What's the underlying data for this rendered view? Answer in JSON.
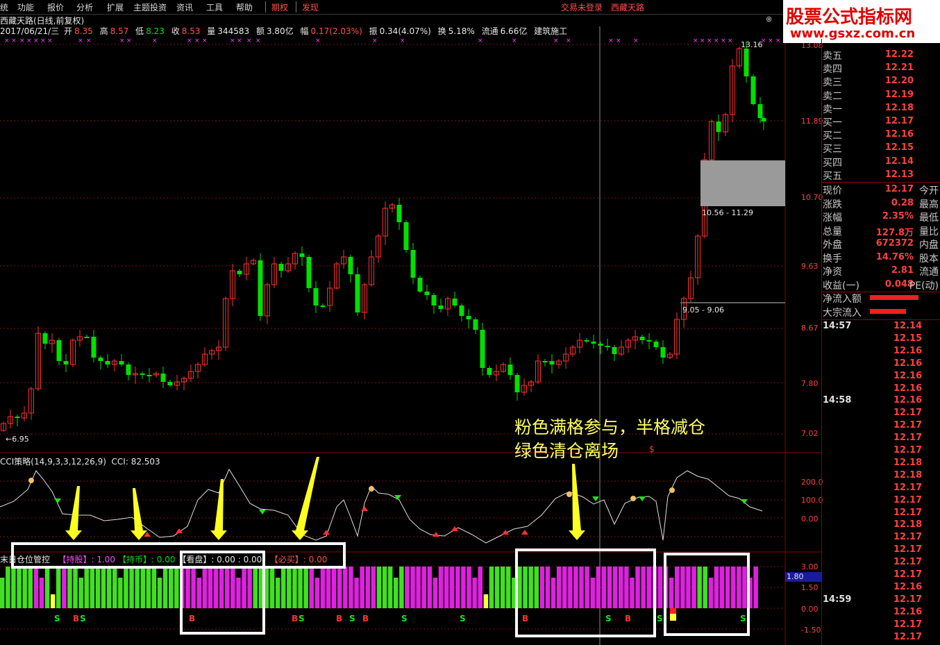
{
  "menubar": {
    "items": [
      "统",
      "功能",
      "报价",
      "分析",
      "扩展",
      "主题投资",
      "资讯",
      "工具",
      "帮助",
      "期权",
      "发现"
    ],
    "status_left": "交易未登录",
    "status_right": "西藏天路",
    "close_glyph": "×"
  },
  "stock": {
    "title": "西藏天路(日线,前复权)",
    "date": "2017/06/21/三",
    "open_label": "开",
    "open": "8.35",
    "high_label": "高",
    "high": "8.57",
    "low_label": "低",
    "low": "8.23",
    "close_label": "收",
    "close": "8.53",
    "vol_label": "量",
    "vol": "344583",
    "amount_label": "额",
    "amount": "3.80亿",
    "change_label": "幅",
    "change": "0.17(2.03%)",
    "amp_label": "振",
    "amp": "0.34(4.07%)",
    "turnover_label": "换",
    "turnover": "5.18%",
    "float_label": "流通",
    "float": "6.66亿",
    "sector": "建筑施工"
  },
  "logo": {
    "line1": "股票公式指标网",
    "line2": "www.gsxz.com.cn"
  },
  "price_axis": [
    "13.08",
    "11.89",
    "10.70",
    "9.63",
    "8.67",
    "7.80",
    "7.02"
  ],
  "price_annotations": {
    "high": "13.16",
    "low": "6.95",
    "zone_high": "10.56 - 11.29",
    "zone_low": "9.05 - 9.06"
  },
  "cci": {
    "title": "CCI策略(14,9,3,3,12,26,9)",
    "value_label": "CCI: 82.503",
    "axis": [
      "200.0",
      "100.0",
      "0.00"
    ]
  },
  "position_panel": {
    "title": "末日仓位管控",
    "hold_label": "【持股】",
    "hold_value": ": 1.00",
    "cash_label": "【持币】",
    "cash_value": ": 0.00",
    "watch_label": "【看盘】",
    "watch_value": ": 0.00 : 0.00",
    "must_buy_label": "【必买】",
    "must_buy_value": ": 0.00",
    "axis": [
      "3.00",
      "1.50",
      "0.00",
      "-1.50"
    ],
    "current_value": "1.80"
  },
  "annotation": {
    "line1": "粉色满格参与，半格减仓",
    "line2": "绿色清仓离场"
  },
  "order_book": [
    {
      "label": "卖五",
      "price": "12.22"
    },
    {
      "label": "卖四",
      "price": "12.21"
    },
    {
      "label": "卖三",
      "price": "12.20"
    },
    {
      "label": "卖二",
      "price": "12.19"
    },
    {
      "label": "卖一",
      "price": "12.18"
    },
    {
      "label": "买一",
      "price": "12.17"
    },
    {
      "label": "买二",
      "price": "12.16"
    },
    {
      "label": "买三",
      "price": "12.15"
    },
    {
      "label": "买四",
      "price": "12.14"
    },
    {
      "label": "买五",
      "price": "12.13"
    }
  ],
  "quote_stats": [
    {
      "label": "现价",
      "value": "12.17",
      "extra": "今开"
    },
    {
      "label": "涨跌",
      "value": "0.28",
      "extra": "最高"
    },
    {
      "label": "涨幅",
      "value": "2.35%",
      "extra": "最低"
    },
    {
      "label": "总量",
      "value": "127.8万",
      "extra": "量比"
    },
    {
      "label": "外盘",
      "value": "672372",
      "extra": "内盘"
    },
    {
      "label": "换手",
      "value": "14.76%",
      "extra": "股本"
    },
    {
      "label": "净资",
      "value": "2.81",
      "extra": "流通"
    },
    {
      "label": "收益(一)",
      "value": "0.048",
      "extra": "PE(动)"
    }
  ],
  "flows": [
    {
      "label": "净流入额"
    },
    {
      "label": "大宗流入"
    }
  ],
  "ticks": [
    {
      "time": "14:57",
      "price": "12.14"
    },
    {
      "time": "",
      "price": "12.15"
    },
    {
      "time": "",
      "price": "12.16"
    },
    {
      "time": "",
      "price": "12.16"
    },
    {
      "time": "",
      "price": "12.16"
    },
    {
      "time": "",
      "price": "12.16"
    },
    {
      "time": "14:58",
      "price": "12.16"
    },
    {
      "time": "",
      "price": "12.17"
    },
    {
      "time": "",
      "price": "12.17"
    },
    {
      "time": "",
      "price": "12.17"
    },
    {
      "time": "",
      "price": "12.17"
    },
    {
      "time": "",
      "price": "12.18"
    },
    {
      "time": "",
      "price": "12.18"
    },
    {
      "time": "",
      "price": "12.17"
    },
    {
      "time": "",
      "price": "12.17"
    },
    {
      "time": "",
      "price": "12.17"
    },
    {
      "time": "",
      "price": "12.18"
    },
    {
      "time": "",
      "price": "12.17"
    },
    {
      "time": "",
      "price": "12.17"
    },
    {
      "time": "",
      "price": "12.17"
    },
    {
      "time": "",
      "price": "12.17"
    },
    {
      "time": "",
      "price": "12.16"
    },
    {
      "time": "14:59",
      "price": "12.17"
    },
    {
      "time": "",
      "price": "12.16"
    },
    {
      "time": "",
      "price": "12.17"
    },
    {
      "time": "",
      "price": "12.17"
    }
  ],
  "signals": {
    "buy": "B",
    "sell": "S"
  },
  "colors": {
    "up": "#ff4040",
    "down": "#00ee00",
    "hold": "#e020e0",
    "cash": "#40e020",
    "warn": "#ffff40",
    "annotation": "#ffff60"
  }
}
